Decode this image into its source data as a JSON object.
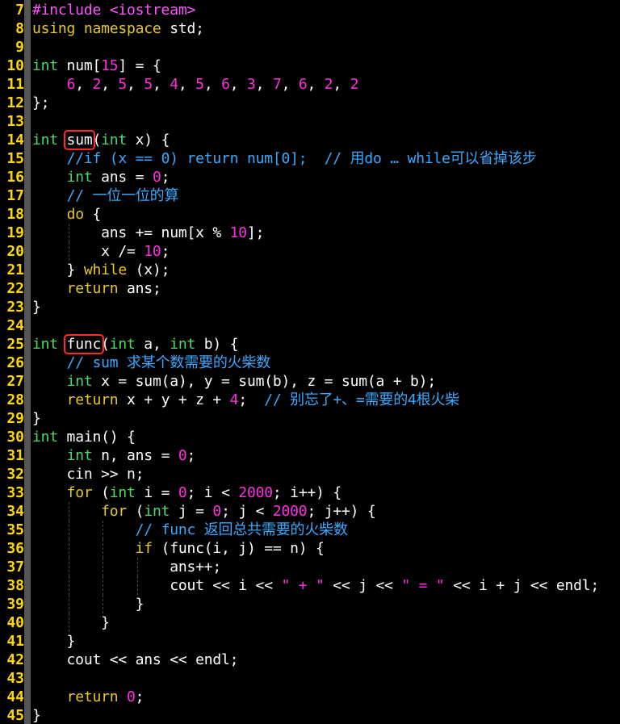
{
  "lines": [
    {
      "n": "7",
      "t": [
        {
          "c": "pp",
          "v": "#include <iostream>"
        }
      ]
    },
    {
      "n": "8",
      "t": [
        {
          "c": "kw",
          "v": "using"
        },
        {
          "c": "",
          "v": " "
        },
        {
          "c": "kw",
          "v": "namespace"
        },
        {
          "c": "",
          "v": " std;"
        }
      ]
    },
    {
      "n": "9",
      "t": []
    },
    {
      "n": "10",
      "t": [
        {
          "c": "tp",
          "v": "int"
        },
        {
          "c": "",
          "v": " num["
        },
        {
          "c": "nm",
          "v": "15"
        },
        {
          "c": "",
          "v": "] = {"
        }
      ]
    },
    {
      "n": "11",
      "t": [
        {
          "c": "",
          "v": "    "
        },
        {
          "c": "nm",
          "v": "6"
        },
        {
          "c": "",
          "v": ", "
        },
        {
          "c": "nm",
          "v": "2"
        },
        {
          "c": "",
          "v": ", "
        },
        {
          "c": "nm",
          "v": "5"
        },
        {
          "c": "",
          "v": ", "
        },
        {
          "c": "nm",
          "v": "5"
        },
        {
          "c": "",
          "v": ", "
        },
        {
          "c": "nm",
          "v": "4"
        },
        {
          "c": "",
          "v": ", "
        },
        {
          "c": "nm",
          "v": "5"
        },
        {
          "c": "",
          "v": ", "
        },
        {
          "c": "nm",
          "v": "6"
        },
        {
          "c": "",
          "v": ", "
        },
        {
          "c": "nm",
          "v": "3"
        },
        {
          "c": "",
          "v": ", "
        },
        {
          "c": "nm",
          "v": "7"
        },
        {
          "c": "",
          "v": ", "
        },
        {
          "c": "nm",
          "v": "6"
        },
        {
          "c": "",
          "v": ", "
        },
        {
          "c": "nm",
          "v": "2"
        },
        {
          "c": "",
          "v": ", "
        },
        {
          "c": "nm",
          "v": "2"
        }
      ]
    },
    {
      "n": "12",
      "t": [
        {
          "c": "",
          "v": "};"
        }
      ]
    },
    {
      "n": "13",
      "t": []
    },
    {
      "n": "14",
      "t": [
        {
          "c": "tp",
          "v": "int"
        },
        {
          "c": "",
          "v": " sum("
        },
        {
          "c": "tp",
          "v": "int"
        },
        {
          "c": "",
          "v": " x) {"
        }
      ]
    },
    {
      "n": "15",
      "t": [
        {
          "c": "",
          "v": "    "
        },
        {
          "c": "cm",
          "v": "//if (x == 0) return num[0];  // 用do … while可以省掉该步"
        }
      ]
    },
    {
      "n": "16",
      "t": [
        {
          "c": "",
          "v": "    "
        },
        {
          "c": "tp",
          "v": "int"
        },
        {
          "c": "",
          "v": " ans = "
        },
        {
          "c": "nm",
          "v": "0"
        },
        {
          "c": "",
          "v": ";"
        }
      ]
    },
    {
      "n": "17",
      "t": [
        {
          "c": "",
          "v": "    "
        },
        {
          "c": "cm",
          "v": "// 一位一位的算"
        }
      ]
    },
    {
      "n": "18",
      "t": [
        {
          "c": "",
          "v": "    "
        },
        {
          "c": "kw",
          "v": "do"
        },
        {
          "c": "",
          "v": " {"
        }
      ]
    },
    {
      "n": "19",
      "t": [
        {
          "c": "",
          "v": "        ans += num[x % "
        },
        {
          "c": "nm",
          "v": "10"
        },
        {
          "c": "",
          "v": "];"
        }
      ]
    },
    {
      "n": "20",
      "t": [
        {
          "c": "",
          "v": "        x /= "
        },
        {
          "c": "nm",
          "v": "10"
        },
        {
          "c": "",
          "v": ";"
        }
      ]
    },
    {
      "n": "21",
      "t": [
        {
          "c": "",
          "v": "    } "
        },
        {
          "c": "kw",
          "v": "while"
        },
        {
          "c": "",
          "v": " (x);"
        }
      ]
    },
    {
      "n": "22",
      "t": [
        {
          "c": "",
          "v": "    "
        },
        {
          "c": "kw",
          "v": "return"
        },
        {
          "c": "",
          "v": " ans;"
        }
      ]
    },
    {
      "n": "23",
      "t": [
        {
          "c": "",
          "v": "}"
        }
      ]
    },
    {
      "n": "24",
      "t": []
    },
    {
      "n": "25",
      "t": [
        {
          "c": "tp",
          "v": "int"
        },
        {
          "c": "",
          "v": " func("
        },
        {
          "c": "tp",
          "v": "int"
        },
        {
          "c": "",
          "v": " a, "
        },
        {
          "c": "tp",
          "v": "int"
        },
        {
          "c": "",
          "v": " b) {"
        }
      ]
    },
    {
      "n": "26",
      "t": [
        {
          "c": "",
          "v": "    "
        },
        {
          "c": "cm",
          "v": "// sum 求某个数需要的火柴数"
        }
      ]
    },
    {
      "n": "27",
      "t": [
        {
          "c": "",
          "v": "    "
        },
        {
          "c": "tp",
          "v": "int"
        },
        {
          "c": "",
          "v": " x = sum(a), y = sum(b), z = sum(a + b);"
        }
      ]
    },
    {
      "n": "28",
      "t": [
        {
          "c": "",
          "v": "    "
        },
        {
          "c": "kw",
          "v": "return"
        },
        {
          "c": "",
          "v": " x + y + z + "
        },
        {
          "c": "nm",
          "v": "4"
        },
        {
          "c": "",
          "v": ";  "
        },
        {
          "c": "cm",
          "v": "// 别忘了+、=需要的4根火柴"
        }
      ]
    },
    {
      "n": "29",
      "t": [
        {
          "c": "",
          "v": "}"
        }
      ]
    },
    {
      "n": "30",
      "t": [
        {
          "c": "tp",
          "v": "int"
        },
        {
          "c": "",
          "v": " main() {"
        }
      ]
    },
    {
      "n": "31",
      "t": [
        {
          "c": "",
          "v": "    "
        },
        {
          "c": "tp",
          "v": "int"
        },
        {
          "c": "",
          "v": " n, ans = "
        },
        {
          "c": "nm",
          "v": "0"
        },
        {
          "c": "",
          "v": ";"
        }
      ]
    },
    {
      "n": "32",
      "t": [
        {
          "c": "",
          "v": "    cin >> n;"
        }
      ]
    },
    {
      "n": "33",
      "t": [
        {
          "c": "",
          "v": "    "
        },
        {
          "c": "kw",
          "v": "for"
        },
        {
          "c": "",
          "v": " ("
        },
        {
          "c": "tp",
          "v": "int"
        },
        {
          "c": "",
          "v": " i = "
        },
        {
          "c": "nm",
          "v": "0"
        },
        {
          "c": "",
          "v": "; i < "
        },
        {
          "c": "nm",
          "v": "2000"
        },
        {
          "c": "",
          "v": "; i++) {"
        }
      ]
    },
    {
      "n": "34",
      "t": [
        {
          "c": "",
          "v": "        "
        },
        {
          "c": "kw",
          "v": "for"
        },
        {
          "c": "",
          "v": " ("
        },
        {
          "c": "tp",
          "v": "int"
        },
        {
          "c": "",
          "v": " j = "
        },
        {
          "c": "nm",
          "v": "0"
        },
        {
          "c": "",
          "v": "; j < "
        },
        {
          "c": "nm",
          "v": "2000"
        },
        {
          "c": "",
          "v": "; j++) {"
        }
      ]
    },
    {
      "n": "35",
      "t": [
        {
          "c": "",
          "v": "            "
        },
        {
          "c": "cm",
          "v": "// func 返回总共需要的火柴数"
        }
      ]
    },
    {
      "n": "36",
      "t": [
        {
          "c": "",
          "v": "            "
        },
        {
          "c": "kw",
          "v": "if"
        },
        {
          "c": "",
          "v": " (func(i, j) == n) {"
        }
      ]
    },
    {
      "n": "37",
      "t": [
        {
          "c": "",
          "v": "                ans++;"
        }
      ]
    },
    {
      "n": "38",
      "t": [
        {
          "c": "",
          "v": "                cout << i << "
        },
        {
          "c": "st",
          "v": "\" + \""
        },
        {
          "c": "",
          "v": " << j << "
        },
        {
          "c": "st",
          "v": "\" = \""
        },
        {
          "c": "",
          "v": " << i + j << endl;"
        }
      ]
    },
    {
      "n": "39",
      "t": [
        {
          "c": "",
          "v": "            }"
        }
      ]
    },
    {
      "n": "40",
      "t": [
        {
          "c": "",
          "v": "        }"
        }
      ]
    },
    {
      "n": "41",
      "t": [
        {
          "c": "",
          "v": "    }"
        }
      ]
    },
    {
      "n": "42",
      "t": [
        {
          "c": "",
          "v": "    cout << ans << endl;"
        }
      ]
    },
    {
      "n": "43",
      "t": []
    },
    {
      "n": "44",
      "t": [
        {
          "c": "",
          "v": "    "
        },
        {
          "c": "kw",
          "v": "return"
        },
        {
          "c": "",
          "v": " "
        },
        {
          "c": "nm",
          "v": "0"
        },
        {
          "c": "",
          "v": ";"
        }
      ]
    },
    {
      "n": "45",
      "t": [
        {
          "c": "",
          "v": "}"
        }
      ]
    }
  ],
  "highlights": [
    "sum",
    "func"
  ],
  "colors": {
    "background": "#000000",
    "line_number": "#ffd700",
    "keyword": "#e6c828",
    "type": "#4cd964",
    "number": "#ff2ee0",
    "comment": "#39a9ff",
    "highlight_box": "#ff2a2a"
  }
}
